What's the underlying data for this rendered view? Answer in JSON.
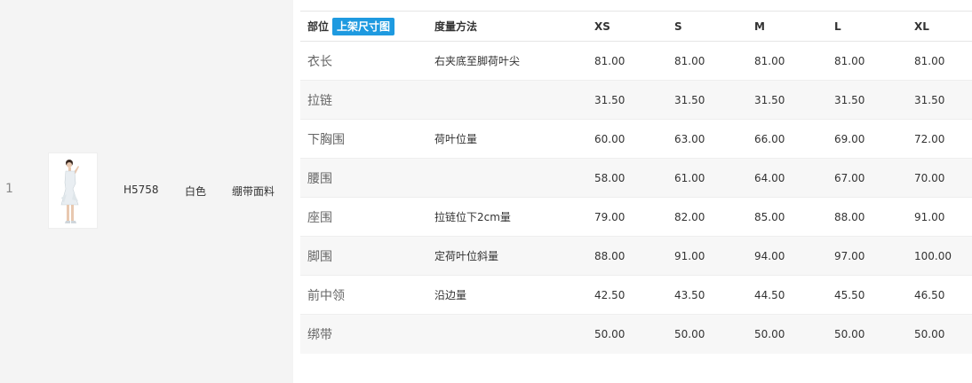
{
  "product": {
    "index": "1",
    "sku": "H5758",
    "color": "白色",
    "material": "绷带面料"
  },
  "table": {
    "header": {
      "part": "部位",
      "tag_button": "上架尺寸图",
      "method": "度量方法",
      "sizes": [
        "XS",
        "S",
        "M",
        "L",
        "XL"
      ]
    },
    "rows": [
      {
        "part": "衣长",
        "method": "右夹底至脚荷叶尖",
        "values": [
          "81.00",
          "81.00",
          "81.00",
          "81.00",
          "81.00"
        ]
      },
      {
        "part": "拉链",
        "method": "",
        "values": [
          "31.50",
          "31.50",
          "31.50",
          "31.50",
          "31.50"
        ]
      },
      {
        "part": "下胸围",
        "method": "荷叶位量",
        "values": [
          "60.00",
          "63.00",
          "66.00",
          "69.00",
          "72.00"
        ]
      },
      {
        "part": "腰围",
        "method": "",
        "values": [
          "58.00",
          "61.00",
          "64.00",
          "67.00",
          "70.00"
        ]
      },
      {
        "part": "座围",
        "method": "拉链位下2cm量",
        "values": [
          "79.00",
          "82.00",
          "85.00",
          "88.00",
          "91.00"
        ]
      },
      {
        "part": "脚围",
        "method": "定荷叶位斜量",
        "values": [
          "88.00",
          "91.00",
          "94.00",
          "97.00",
          "100.00"
        ]
      },
      {
        "part": "前中领",
        "method": "沿边量",
        "values": [
          "42.50",
          "43.50",
          "44.50",
          "45.50",
          "46.50"
        ]
      },
      {
        "part": "绑带",
        "method": "",
        "values": [
          "50.00",
          "50.00",
          "50.00",
          "50.00",
          "50.00"
        ]
      }
    ]
  },
  "colors": {
    "tag_button_bg": "#1e9ae0",
    "left_panel_bg": "#f4f4f4",
    "alt_row_bg": "#f7f7f7"
  },
  "icons": {
    "product_image": "white-dress-model-photo"
  }
}
